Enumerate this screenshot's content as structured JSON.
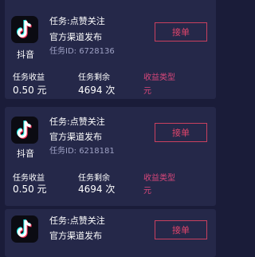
{
  "cards": [
    {
      "app_name": "抖音",
      "task": "任务:点赞关注",
      "channel": "官方渠道发布",
      "task_id": "任务ID:  6728136",
      "button": "接单",
      "income_label": "任务收益",
      "income_value": "0.50 元",
      "remaining_label": "任务剩余",
      "remaining_value": "4694 次",
      "type_label": "收益类型",
      "type_value": "元"
    },
    {
      "app_name": "抖音",
      "task": "任务:点赞关注",
      "channel": "官方渠道发布",
      "task_id": "任务ID:  6218181",
      "button": "接单",
      "income_label": "任务收益",
      "income_value": "0.50 元",
      "remaining_label": "任务剩余",
      "remaining_value": "4694 次",
      "type_label": "收益类型",
      "type_value": "元"
    },
    {
      "task": "任务:点赞关注",
      "channel": "官方渠道发布",
      "button": "接单"
    }
  ],
  "colors": {
    "background": "#1a1c39",
    "card": "#252849",
    "accent": "#e0456b",
    "muted": "#9ea1c4"
  },
  "icons": {
    "app_logo": "tiktok-note-icon"
  }
}
